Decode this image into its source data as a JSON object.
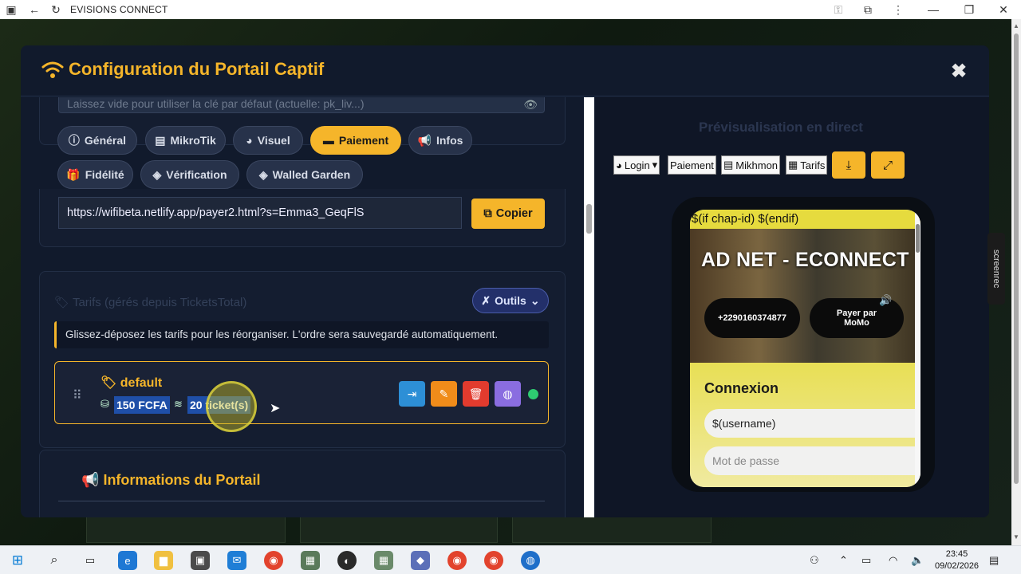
{
  "browser": {
    "title": "EVISIONS CONNECT"
  },
  "modal": {
    "title": "Configuration du Portail Captif",
    "key_placeholder": "Laissez vide pour utiliser la clé par défaut (actuelle: pk_liv...)",
    "tabs": [
      {
        "label": "Général",
        "icon": "info-icon"
      },
      {
        "label": "MikroTik",
        "icon": "server-icon"
      },
      {
        "label": "Visuel",
        "icon": "palette-icon"
      },
      {
        "label": "Paiement",
        "icon": "card-icon",
        "active": true
      },
      {
        "label": "Infos",
        "icon": "megaphone-icon"
      },
      {
        "label": "Fidélité",
        "icon": "gift-icon"
      },
      {
        "label": "Vérification",
        "icon": "shield-icon"
      },
      {
        "label": "Walled Garden",
        "icon": "shield-icon"
      }
    ],
    "payment_url": "https://wifibeta.netlify.app/payer2.html?s=Emma3_GeqFlS",
    "copy_label": "Copier",
    "tarifs": {
      "title": "Tarifs (gérés depuis TicketsTotal)",
      "tools_label": "Outils",
      "note": "Glissez-déposez les tarifs pour les réorganiser. L'ordre sera sauvegardé automatiquement.",
      "items": [
        {
          "name": "default",
          "price": "150 FCFA",
          "tickets": "20 ticket(s)",
          "status": "active"
        }
      ]
    },
    "info_title": "Informations du Portail"
  },
  "preview": {
    "title": "Prévisualisation en direct",
    "toolbar": [
      "Login",
      "Paiement",
      "Mikhmon",
      "Tarifs"
    ],
    "phone": {
      "header": "$(if chap-id) $(endif)",
      "brand": "AD NET - ECONNECT",
      "phone_button": "+2290160374877",
      "pay_button": "Payer par MoMo",
      "login_title": "Connexion",
      "username": "$(username)",
      "password_placeholder": "Mot de passe"
    }
  },
  "side_badge": "screenrec",
  "taskbar": {
    "time": "23:45",
    "date": "09/02/2026"
  },
  "colors": {
    "accent": "#f5b52a",
    "modal_bg": "#111a2c",
    "status_dot": "#2ecc71"
  }
}
